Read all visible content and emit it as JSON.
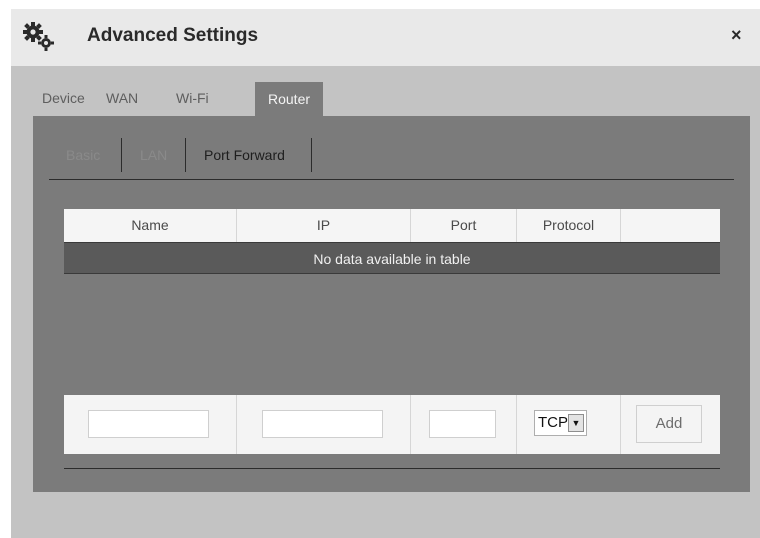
{
  "window": {
    "title": "Advanced Settings",
    "close_label": "×"
  },
  "top_tabs": [
    {
      "label": "Device"
    },
    {
      "label": "WAN"
    },
    {
      "label": "Wi-Fi"
    },
    {
      "label": "Router",
      "active": true
    }
  ],
  "sub_tabs": [
    {
      "label": "Basic"
    },
    {
      "label": "LAN"
    },
    {
      "label": "Port Forward",
      "active": true
    }
  ],
  "table": {
    "columns": [
      "Name",
      "IP",
      "Port",
      "Protocol",
      ""
    ],
    "empty_message": "No data available in table"
  },
  "form": {
    "name_value": "",
    "ip_value": "",
    "port_value": "",
    "protocol_selected": "TCP",
    "add_label": "Add"
  },
  "icons": {
    "title": "gears-icon",
    "close": "close-icon",
    "dropdown": "chevron-down-icon"
  }
}
